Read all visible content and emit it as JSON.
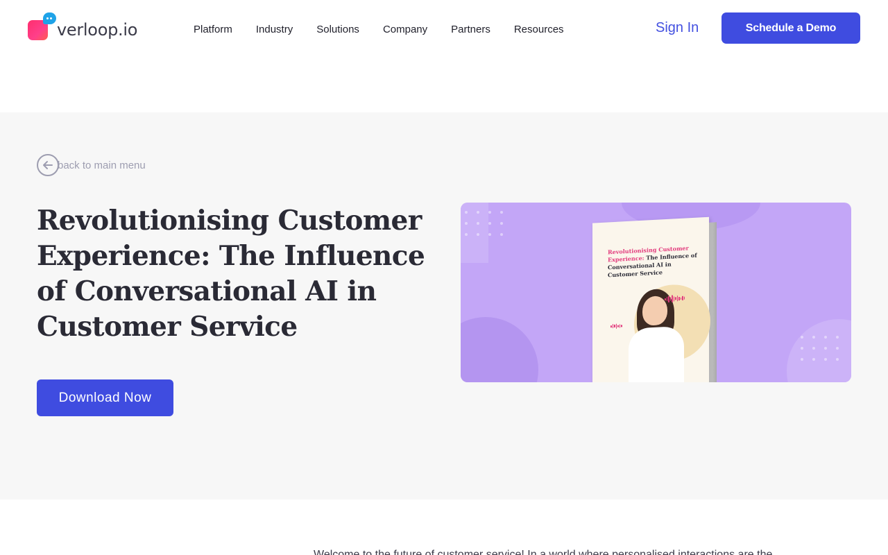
{
  "header": {
    "logo_text": "verloop.io",
    "nav": [
      "Platform",
      "Industry",
      "Solutions",
      "Company",
      "Partners",
      "Resources"
    ],
    "signin_label": "Sign In",
    "demo_label": "Schedule a Demo"
  },
  "hero": {
    "back_label": "back to main menu",
    "title": "Revolutionising Customer Experience: The Influence of Conversational AI in Customer Service",
    "download_label": "Download Now",
    "book": {
      "title_pink": "Revolutionising Customer Experience:",
      "title_dark": "The Influence of Conversational AI in Customer Service"
    }
  },
  "body": {
    "intro": "Welcome to the future of customer service! In a world where personalised interactions are the"
  },
  "colors": {
    "accent": "#3f4ce0",
    "hero_bg": "#f7f7f7",
    "image_bg": "#c3a6f7",
    "logo_pink": "#ff2e6e",
    "logo_blue": "#1fa3e8"
  }
}
